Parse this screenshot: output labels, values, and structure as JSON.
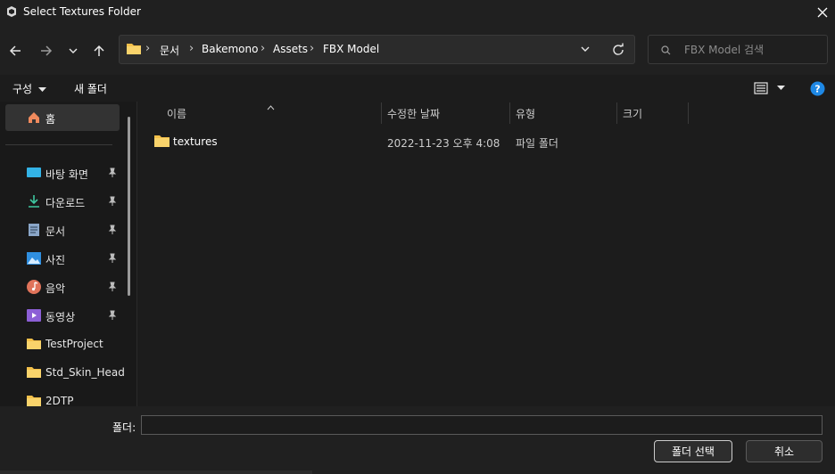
{
  "window": {
    "title": "Select Textures Folder",
    "close_icon": "close-icon"
  },
  "nav": {
    "back": "back-arrow-icon",
    "forward": "forward-arrow-icon",
    "recent": "chevron-down-icon",
    "up": "up-arrow-icon"
  },
  "address": {
    "crumbs": [
      "문서",
      "Bakemono",
      "Assets",
      "FBX Model"
    ]
  },
  "search": {
    "placeholder": "FBX Model 검색"
  },
  "toolbar": {
    "organize": "구성",
    "new_folder": "새 폴더"
  },
  "sidebar": {
    "home": "홈",
    "items": [
      {
        "label": "바탕 화면",
        "pinned": true
      },
      {
        "label": "다운로드",
        "pinned": true
      },
      {
        "label": "문서",
        "pinned": true
      },
      {
        "label": "사진",
        "pinned": true
      },
      {
        "label": "음악",
        "pinned": true
      },
      {
        "label": "동영상",
        "pinned": true
      },
      {
        "label": "TestProject",
        "pinned": false
      },
      {
        "label": "Std_Skin_Head",
        "pinned": false
      },
      {
        "label": "2DTP",
        "pinned": false
      }
    ]
  },
  "columns": {
    "name": "이름",
    "modified": "수정한 날짜",
    "type": "유형",
    "size": "크기"
  },
  "files": [
    {
      "name": "textures",
      "modified": "2022-11-23 오후 4:08",
      "type": "파일 폴더",
      "size": ""
    }
  ],
  "footer": {
    "folder_label": "폴더:",
    "folder_value": "",
    "select_button": "폴더 선택",
    "cancel_button": "취소"
  },
  "colors": {
    "accent": "#4aa3ff",
    "folder": "#f4c04a",
    "background": "#1c1c1c"
  }
}
